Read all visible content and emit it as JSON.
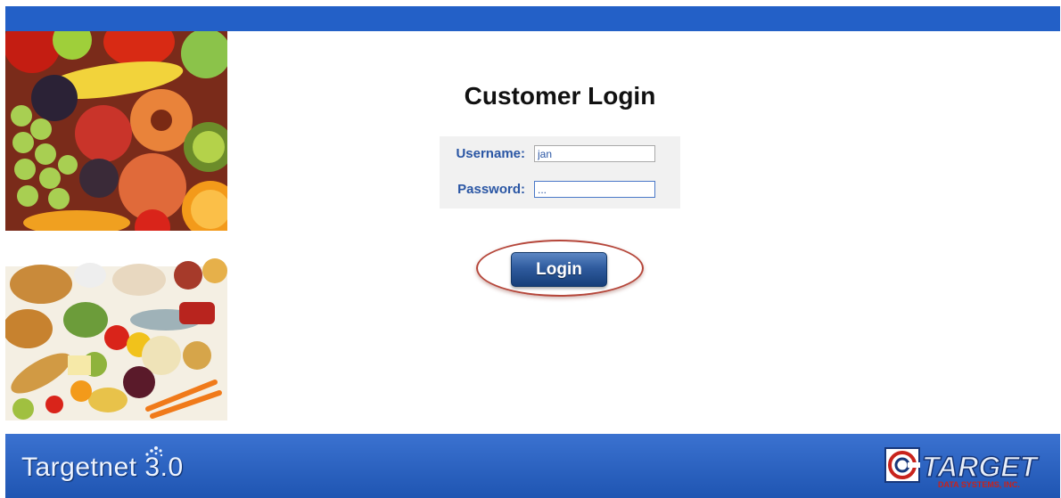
{
  "header": {
    "color": "#2360c7"
  },
  "images": {
    "fruit": {
      "icon": "fruit-photo"
    },
    "grocery": {
      "icon": "groceries-photo"
    }
  },
  "login_form": {
    "title": "Customer Login",
    "username_label": "Username:",
    "username_value": "jan",
    "password_label": "Password:",
    "password_value": "...",
    "login_button": "Login",
    "highlight_color": "#b5463a"
  },
  "footer": {
    "app_title": "Targetnet 3.0",
    "logo_text": "TARGET",
    "logo_subtext": "DATA SYSTEMS, INC.",
    "color": "#2a5fc0"
  }
}
